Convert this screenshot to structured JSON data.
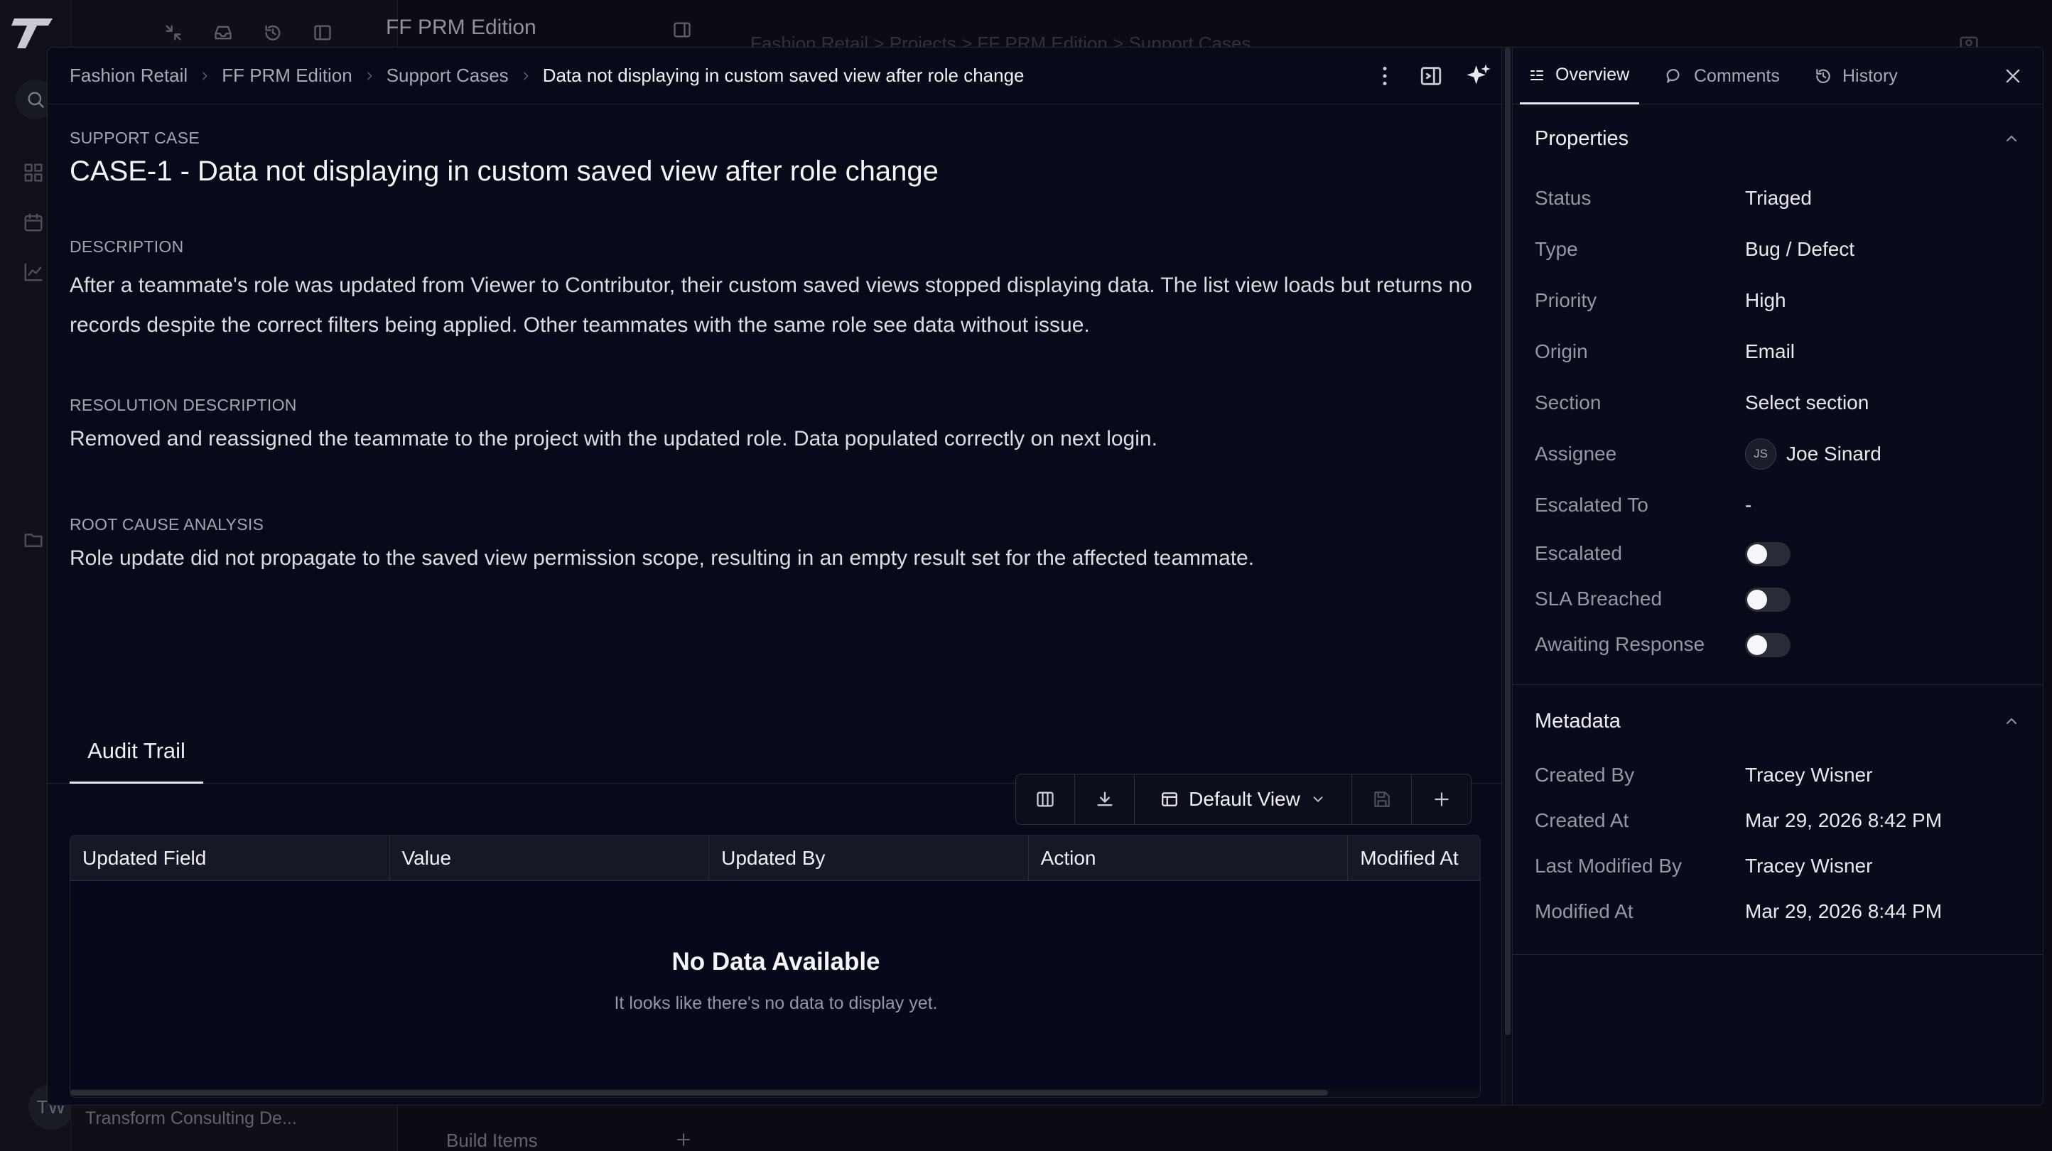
{
  "background": {
    "project_title": "FF PRM Edition",
    "breadcrumb": "Fashion Retail  >  Projects  >  FF PRM Edition  >  Support Cases",
    "user_initials": "TW",
    "user_org": "Transform Consulting De...",
    "build_items": "Build Items"
  },
  "breadcrumb": {
    "items": [
      "Fashion Retail",
      "FF PRM Edition",
      "Support Cases"
    ],
    "current": "Data not displaying in custom saved view after role change"
  },
  "case": {
    "kind_label": "SUPPORT CASE",
    "title": "CASE-1 - Data not displaying in custom saved view after role change",
    "description_label": "DESCRIPTION",
    "description": "After a teammate's role was updated from Viewer to Contributor, their custom saved views stopped displaying data. The list view loads but returns no records despite the correct filters being applied. Other teammates with the same role see data without issue.",
    "resolution_label": "RESOLUTION DESCRIPTION",
    "resolution": "Removed and reassigned the teammate to the project with the updated role. Data populated correctly on next login.",
    "rca_label": "ROOT CAUSE ANALYSIS",
    "rca": "Role update did not propagate to the saved view permission scope, resulting in an empty result set for the affected teammate."
  },
  "audit": {
    "tab_label": "Audit Trail",
    "view_select": "Default View",
    "columns": [
      "Updated Field",
      "Value",
      "Updated By",
      "Action",
      "Modified At"
    ],
    "empty_title": "No Data Available",
    "empty_subtitle": "It looks like there's no data to display yet."
  },
  "side": {
    "tabs": {
      "overview": "Overview",
      "comments": "Comments",
      "history": "History"
    },
    "properties_title": "Properties",
    "properties": {
      "status": {
        "label": "Status",
        "value": "Triaged"
      },
      "type": {
        "label": "Type",
        "value": "Bug / Defect"
      },
      "priority": {
        "label": "Priority",
        "value": "High"
      },
      "origin": {
        "label": "Origin",
        "value": "Email"
      },
      "section": {
        "label": "Section",
        "value": "Select section"
      },
      "assignee": {
        "label": "Assignee",
        "initials": "JS",
        "value": "Joe Sinard"
      },
      "escalated_to": {
        "label": "Escalated To",
        "value": "-"
      },
      "escalated": {
        "label": "Escalated",
        "on": false
      },
      "sla_breached": {
        "label": "SLA Breached",
        "on": false
      },
      "awaiting_response": {
        "label": "Awaiting Response",
        "on": false
      }
    },
    "metadata_title": "Metadata",
    "metadata": {
      "created_by": {
        "label": "Created By",
        "value": "Tracey Wisner"
      },
      "created_at": {
        "label": "Created At",
        "value": "Mar 29, 2026 8:42 PM"
      },
      "last_modified_by": {
        "label": "Last Modified By",
        "value": "Tracey Wisner"
      },
      "modified_at": {
        "label": "Modified At",
        "value": "Mar 29, 2026 8:44 PM"
      }
    }
  },
  "colors": {
    "accent": "#e8e9ee",
    "surface": "#07081a",
    "toggle_off": "#2a2c38"
  }
}
